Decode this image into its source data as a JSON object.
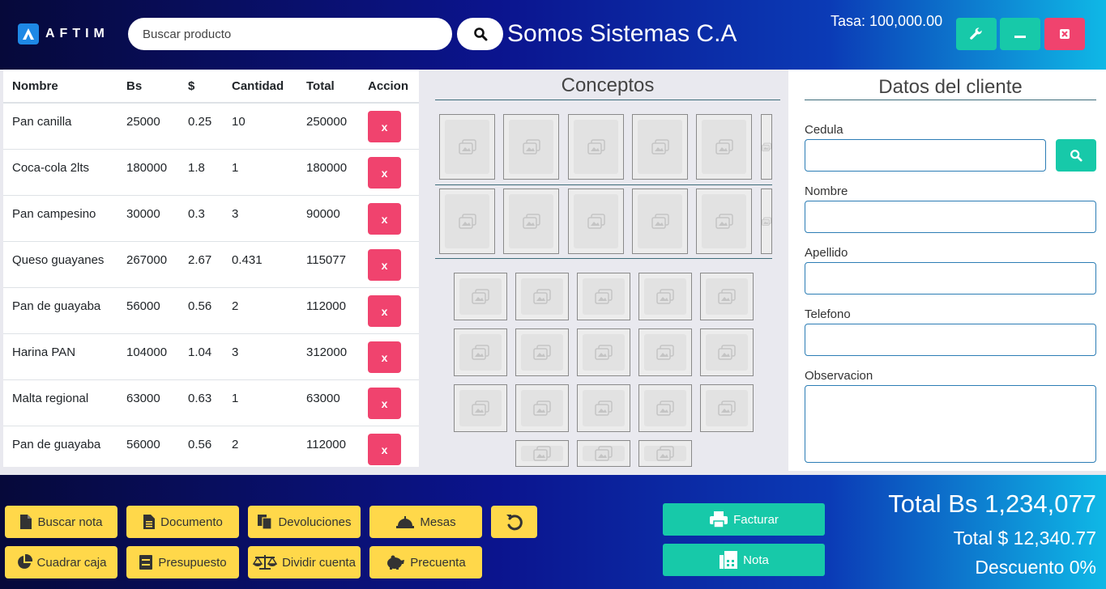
{
  "header": {
    "logo_text": "AFTIM",
    "search_placeholder": "Buscar producto",
    "company_name": "Somos Sistemas C.A",
    "tasa": "Tasa: 100,000.00"
  },
  "table": {
    "headers": [
      "Nombre",
      "Bs",
      "$",
      "Cantidad",
      "Total",
      "Accion"
    ],
    "delete_label": "x",
    "rows": [
      {
        "nombre": "Pan canilla",
        "bs": "25000",
        "usd": "0.25",
        "cantidad": "10",
        "total": "250000"
      },
      {
        "nombre": "Coca-cola 2lts",
        "bs": "180000",
        "usd": "1.8",
        "cantidad": "1",
        "total": "180000"
      },
      {
        "nombre": "Pan campesino",
        "bs": "30000",
        "usd": "0.3",
        "cantidad": "3",
        "total": "90000"
      },
      {
        "nombre": "Queso guayanes",
        "bs": "267000",
        "usd": "2.67",
        "cantidad": "0.431",
        "total": "115077"
      },
      {
        "nombre": "Pan de guayaba",
        "bs": "56000",
        "usd": "0.56",
        "cantidad": "2",
        "total": "112000"
      },
      {
        "nombre": "Harina PAN",
        "bs": "104000",
        "usd": "1.04",
        "cantidad": "3",
        "total": "312000"
      },
      {
        "nombre": "Malta regional",
        "bs": "63000",
        "usd": "0.63",
        "cantidad": "1",
        "total": "63000"
      },
      {
        "nombre": "Pan de guayaba",
        "bs": "56000",
        "usd": "0.56",
        "cantidad": "2",
        "total": "112000"
      }
    ]
  },
  "concepts": {
    "title": "Conceptos"
  },
  "client": {
    "title": "Datos del cliente",
    "fields": {
      "cedula": "Cedula",
      "nombre": "Nombre",
      "apellido": "Apellido",
      "telefono": "Telefono",
      "observacion": "Observacion"
    }
  },
  "actions": {
    "buscar_nota": "Buscar nota",
    "documento": "Documento",
    "devoluciones": "Devoluciones",
    "mesas": "Mesas",
    "cuadrar_caja": "Cuadrar caja",
    "presupuesto": "Presupuesto",
    "dividir_cuenta": "Dividir cuenta",
    "precuenta": "Precuenta",
    "facturar": "Facturar",
    "nota": "Nota"
  },
  "totals": {
    "total_bs": "Total Bs 1,234,077",
    "total_usd": "Total $ 12,340.77",
    "descuento": "Descuento 0%"
  },
  "colors": {
    "accent_teal": "#17c9a9",
    "danger": "#f0436e",
    "warning": "#ffd84a",
    "navy": "#0b148e"
  }
}
